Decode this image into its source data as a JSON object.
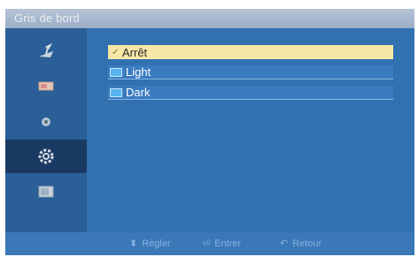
{
  "title": "Gris de bord",
  "sidebar": {
    "items": [
      {
        "icon": "input-antenna-icon",
        "active": false
      },
      {
        "icon": "picture-icon",
        "active": false
      },
      {
        "icon": "sound-icon",
        "active": false
      },
      {
        "icon": "setup-gear-icon",
        "active": true
      },
      {
        "icon": "multi-control-icon",
        "active": false
      }
    ]
  },
  "options": [
    {
      "label": "Arrêt",
      "selected": true,
      "check": "✓"
    },
    {
      "label": "Light",
      "selected": false
    },
    {
      "label": "Dark",
      "selected": false
    }
  ],
  "footer": {
    "adjust": {
      "glyph": "⬍",
      "label": "Régler"
    },
    "enter": {
      "glyph": "⏎",
      "label": "Entrer"
    },
    "back": {
      "glyph": "↶",
      "label": "Retour"
    }
  },
  "colors": {
    "panel": "#2f6aa8",
    "highlight": "#f7e7a7",
    "active_nav": "#1a3a63"
  }
}
